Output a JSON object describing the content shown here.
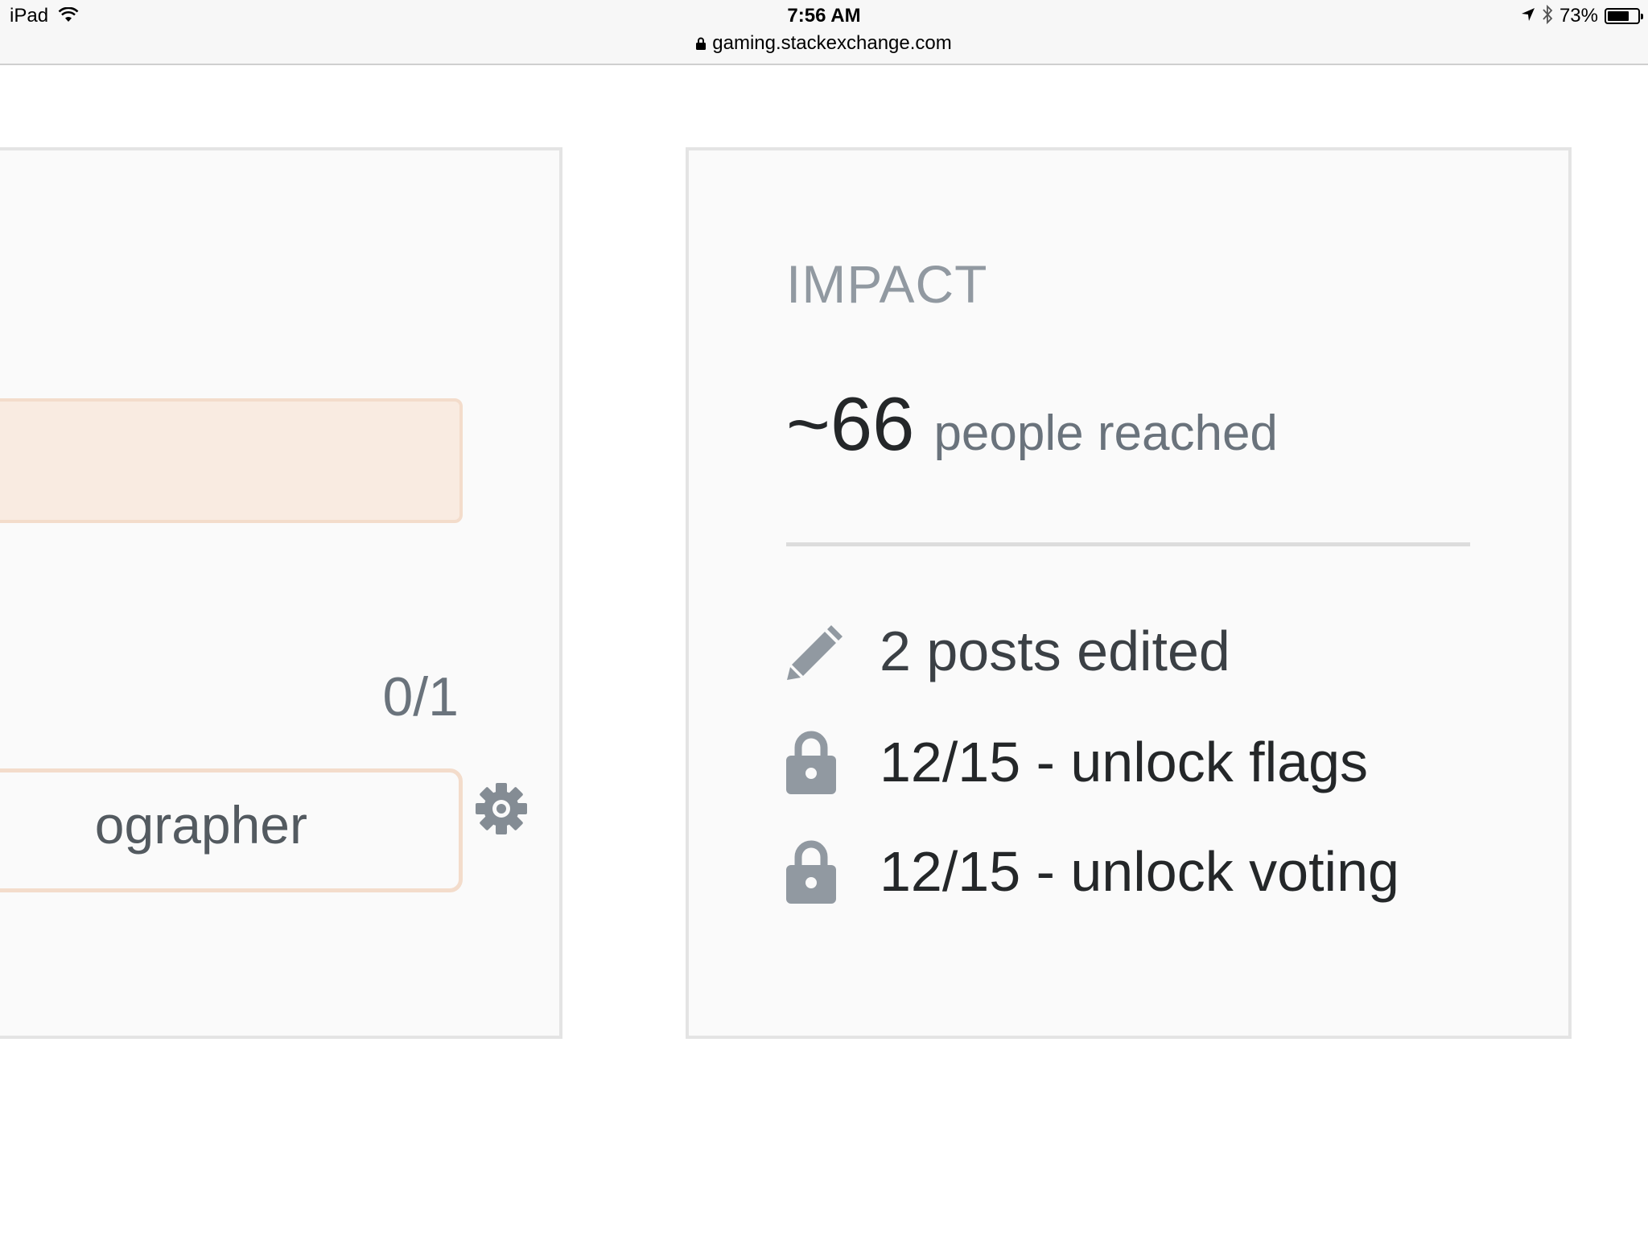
{
  "status_bar": {
    "device": "iPad",
    "time": "7:56 AM",
    "url": "gaming.stackexchange.com",
    "battery_percent": "73%",
    "battery_level": 0.73,
    "icons": [
      "wifi-icon",
      "lock-icon",
      "location-icon",
      "bluetooth-icon",
      "battery-icon"
    ]
  },
  "left_card": {
    "progress": "0/1",
    "field_value": "ographer",
    "settings_icon": "gear-icon"
  },
  "impact": {
    "title": "IMPACT",
    "reach_number": "~66",
    "reach_label": "people reached",
    "stats": [
      {
        "icon": "pencil-icon",
        "text": "2 posts edited"
      },
      {
        "icon": "lock-icon",
        "text": "12/15 - unlock flags"
      },
      {
        "icon": "lock-icon",
        "text": "12/15 - unlock voting"
      }
    ]
  },
  "colors": {
    "card_background": "#fafafa",
    "card_border": "#e4e4e4",
    "banner_background": "#f9ebe1",
    "banner_border": "#f3dccb",
    "icon_gray": "#9199a1"
  }
}
